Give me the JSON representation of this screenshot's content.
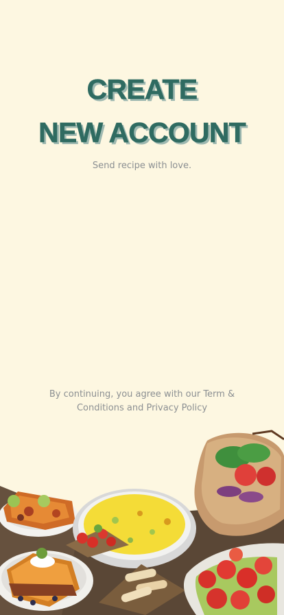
{
  "title": {
    "line1": "CREATE",
    "line2": "NEW ACCOUNT"
  },
  "subtitle": "Send recipe with love.",
  "consent": {
    "text": "By continuing, you agree with our Term & Conditions and Privacy Policy"
  },
  "colors": {
    "background": "#fdf7e1",
    "title": "#2f6b61",
    "title_shadow": "#9fb9b1",
    "muted_text": "#8b8f92",
    "ground": "#5a4736"
  }
}
